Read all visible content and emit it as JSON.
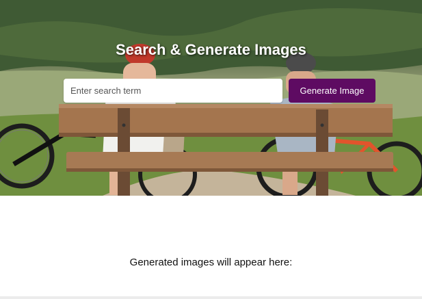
{
  "header": {
    "title": "Search & Generate Images",
    "background": "photo-cyclists-on-bench"
  },
  "search": {
    "placeholder": "Enter search term",
    "value": "",
    "button_label": "Generate Image"
  },
  "results": {
    "empty_text": "Generated images will appear here:"
  },
  "colors": {
    "button": "#5e0b62",
    "button_text": "#ffffff",
    "title_text": "#ffffff"
  }
}
